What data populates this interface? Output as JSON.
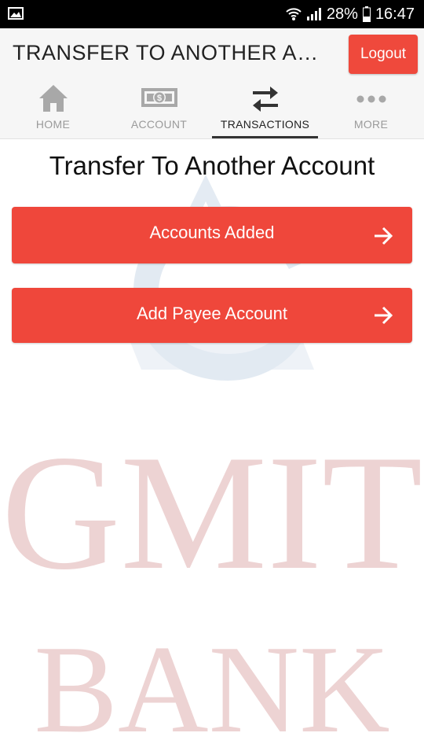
{
  "status_bar": {
    "battery": "28%",
    "time": "16:47"
  },
  "header": {
    "title": "TRANSFER TO ANOTHER ACC...",
    "logout_label": "Logout"
  },
  "tabs": [
    {
      "label": "HOME",
      "icon": "home-icon"
    },
    {
      "label": "ACCOUNT",
      "icon": "banknote-icon"
    },
    {
      "label": "TRANSACTIONS",
      "icon": "swap-arrows-icon",
      "active": true
    },
    {
      "label": "MORE",
      "icon": "more-dots-icon"
    }
  ],
  "main": {
    "title": "Transfer To Another Account",
    "buttons": [
      {
        "label": "Accounts Added"
      },
      {
        "label": "Add Payee Account"
      }
    ]
  },
  "watermark": {
    "line1": "GMIT",
    "line2": "BANK"
  },
  "colors": {
    "accent": "#ef473b",
    "header_bg": "#f6f6f6",
    "status_bar": "#000000"
  }
}
